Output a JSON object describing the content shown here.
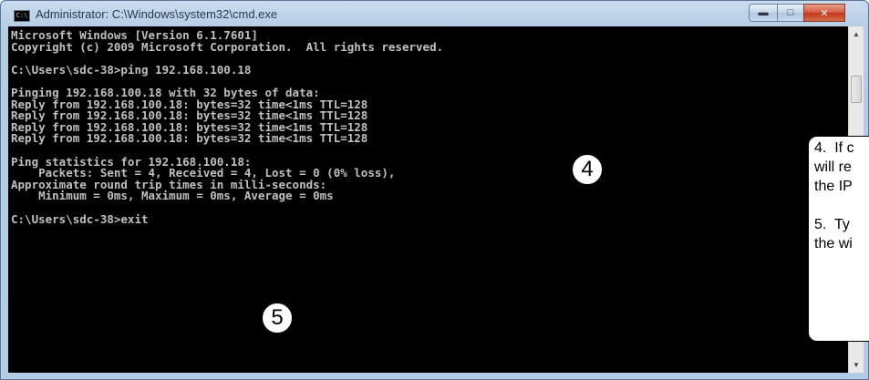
{
  "window": {
    "title": "Administrator: C:\\Windows\\system32\\cmd.exe",
    "icon": "cmd-icon",
    "controls": {
      "minimize": "minimize-icon",
      "maximize": "maximize-icon",
      "close": "close-icon"
    }
  },
  "console": {
    "lines": [
      "Microsoft Windows [Version 6.1.7601]",
      "Copyright (c) 2009 Microsoft Corporation.  All rights reserved.",
      "",
      "C:\\Users\\sdc-38>ping 192.168.100.18",
      "",
      "Pinging 192.168.100.18 with 32 bytes of data:",
      "Reply from 192.168.100.18: bytes=32 time<1ms TTL=128",
      "Reply from 192.168.100.18: bytes=32 time<1ms TTL=128",
      "Reply from 192.168.100.18: bytes=32 time<1ms TTL=128",
      "Reply from 192.168.100.18: bytes=32 time<1ms TTL=128",
      "",
      "Ping statistics for 192.168.100.18:",
      "    Packets: Sent = 4, Received = 4, Lost = 0 (0% loss),",
      "Approximate round trip times in milli-seconds:",
      "    Minimum = 0ms, Maximum = 0ms, Average = 0ms",
      "",
      "C:\\Users\\sdc-38>exit"
    ],
    "colors": {
      "background": "#000000",
      "text": "#c0c0c0"
    }
  },
  "annotations": {
    "step4": "4",
    "step5": "5"
  },
  "callout": {
    "text": "4.  If c\nwill re\nthe IP\n\n5.  Ty\nthe wi"
  }
}
